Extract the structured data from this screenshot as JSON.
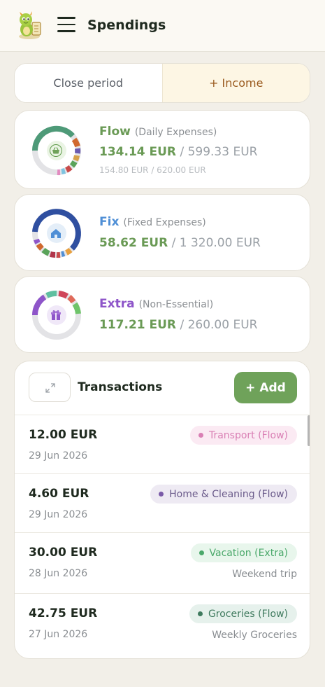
{
  "header": {
    "title": "Spendings",
    "logo_icon": "dragon-mascot-icon",
    "menu_icon": "hamburger-menu-icon"
  },
  "tabs": {
    "close_period": "Close period",
    "income": "+ Income"
  },
  "categories": [
    {
      "name": "Flow",
      "subtitle": "(Daily Expenses)",
      "spent": "134.14 EUR",
      "budget": "/ 599.33 EUR",
      "secondary": "154.80 EUR / 620.00 EUR",
      "icon": "basket-icon",
      "color_name": "#6a9a55",
      "spent_fraction": 0.22
    },
    {
      "name": "Fix",
      "subtitle": "(Fixed Expenses)",
      "spent": "58.62 EUR",
      "budget": "/ 1 320.00 EUR",
      "icon": "house-icon",
      "color_name": "#4f8fd6",
      "spent_fraction": 0.04
    },
    {
      "name": "Extra",
      "subtitle": "(Non-Essential)",
      "spent": "117.21 EUR",
      "budget": "/ 260.00 EUR",
      "icon": "gift-icon",
      "color_name": "#8e55c9",
      "spent_fraction": 0.45
    }
  ],
  "transactions": {
    "title": "Transactions",
    "add_label": "+ Add",
    "expand_icon": "expand-arrows-icon",
    "items": [
      {
        "amount": "12.00 EUR",
        "date": "29 Jun 2026",
        "tag": "Transport (Flow)",
        "note": "",
        "tag_color": "#d97fb4",
        "tag_bg": "#fbeaf3"
      },
      {
        "amount": "4.60 EUR",
        "date": "29 Jun 2026",
        "tag": "Home & Cleaning (Flow)",
        "note": "",
        "tag_color": "#6a5a8a",
        "tag_bg": "#eeeaf3"
      },
      {
        "amount": "30.00 EUR",
        "date": "28 Jun 2026",
        "tag": "Vacation (Extra)",
        "note": "Weekend trip",
        "tag_color": "#4aa86a",
        "tag_bg": "#e8f6ec"
      },
      {
        "amount": "42.75 EUR",
        "date": "27 Jun 2026",
        "tag": "Groceries (Flow)",
        "note": "Weekly Groceries",
        "tag_color": "#3f7a5e",
        "tag_bg": "#e6f1ec"
      }
    ]
  }
}
